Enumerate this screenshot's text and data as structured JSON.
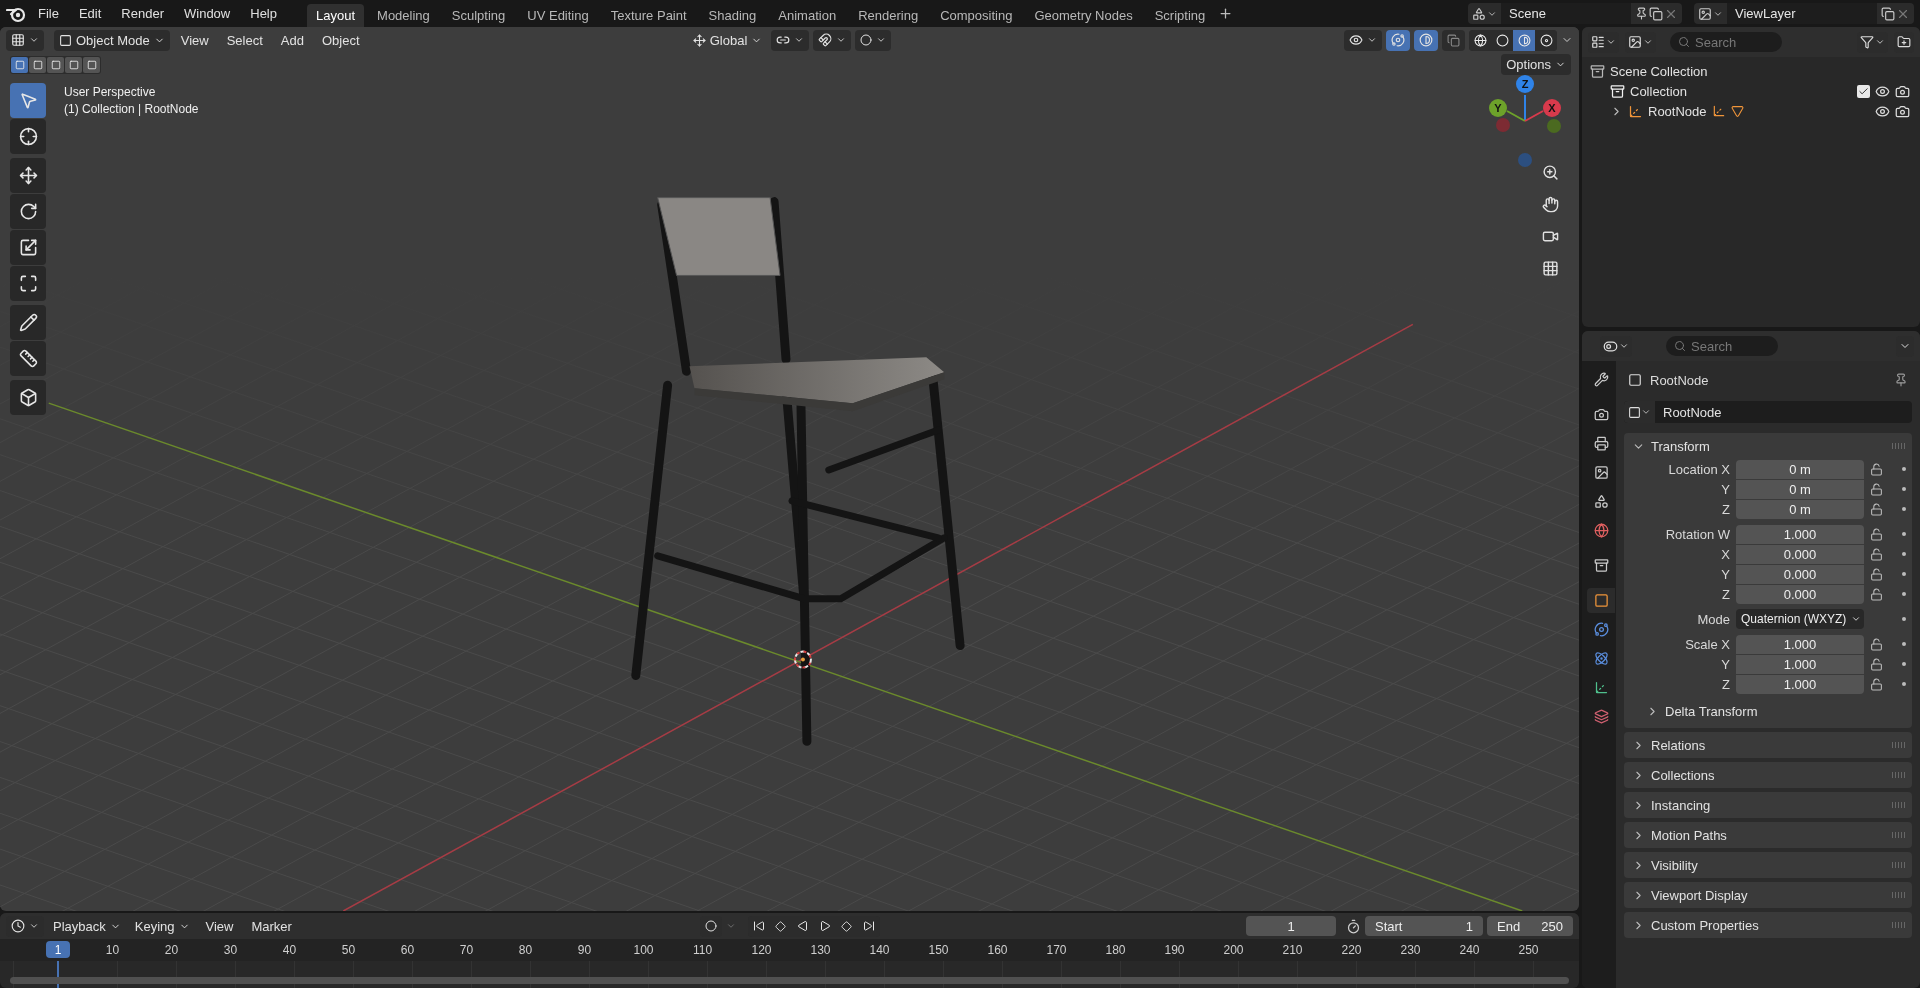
{
  "menu": [
    "File",
    "Edit",
    "Render",
    "Window",
    "Help"
  ],
  "workspaces": [
    {
      "label": "Layout",
      "selected": true
    },
    {
      "label": "Modeling",
      "selected": false
    },
    {
      "label": "Sculpting",
      "selected": false
    },
    {
      "label": "UV Editing",
      "selected": false
    },
    {
      "label": "Texture Paint",
      "selected": false
    },
    {
      "label": "Shading",
      "selected": false
    },
    {
      "label": "Animation",
      "selected": false
    },
    {
      "label": "Rendering",
      "selected": false
    },
    {
      "label": "Compositing",
      "selected": false
    },
    {
      "label": "Geometry Nodes",
      "selected": false
    },
    {
      "label": "Scripting",
      "selected": false
    }
  ],
  "scene": "Scene",
  "view_layer": "ViewLayer",
  "viewport": {
    "mode": "Object Mode",
    "menus": [
      "View",
      "Select",
      "Add",
      "Object"
    ],
    "orientation": "Global",
    "options": "Options",
    "view_name": "User Perspective",
    "view_info": "(1) Collection | RootNode",
    "select_modes": [
      {
        "selected": true
      },
      {
        "selected": false
      },
      {
        "selected": false
      },
      {
        "selected": false
      },
      {
        "selected": false
      }
    ],
    "tools": [
      {
        "kind": "select",
        "selected": true
      },
      {
        "kind": "cursor",
        "selected": false
      },
      {
        "kind": "move",
        "selected": false
      },
      {
        "kind": "rotate",
        "selected": false
      },
      {
        "kind": "scale",
        "selected": false
      },
      {
        "kind": "transform",
        "selected": false
      },
      {
        "kind": "annotate",
        "selected": false
      },
      {
        "kind": "measure",
        "selected": false
      },
      {
        "kind": "add_cube",
        "selected": false
      }
    ],
    "shading": [
      {
        "kind": "wireframe",
        "selected": false
      },
      {
        "kind": "solid",
        "selected": false
      },
      {
        "kind": "material",
        "selected": true
      },
      {
        "kind": "rendered",
        "selected": false
      }
    ],
    "gizmo": [
      {
        "kind": "z",
        "label": "Z"
      },
      {
        "kind": "y",
        "label": "Y"
      },
      {
        "kind": "x",
        "label": "X"
      }
    ]
  },
  "outliner": {
    "search_placeholder": "Search",
    "tree": [
      {
        "label": "Scene Collection",
        "kind": "scene_collection",
        "children": [
          {
            "label": "Collection",
            "kind": "collection",
            "checked": true
          },
          {
            "label": "RootNode",
            "kind": "empty",
            "expanded": false
          }
        ]
      }
    ]
  },
  "properties": {
    "search_placeholder": "Search",
    "tabs": [
      {
        "kind": "tool",
        "selected": false
      },
      {
        "kind": "render",
        "selected": false
      },
      {
        "kind": "output",
        "selected": false
      },
      {
        "kind": "view_layer",
        "selected": false
      },
      {
        "kind": "scene",
        "selected": false
      },
      {
        "kind": "world",
        "selected": false
      },
      {
        "kind": "collection",
        "selected": false
      },
      {
        "kind": "object",
        "selected": true
      },
      {
        "kind": "physics",
        "selected": false
      },
      {
        "kind": "constraints",
        "selected": false
      },
      {
        "kind": "data",
        "selected": false
      },
      {
        "kind": "texture",
        "selected": false
      }
    ],
    "object_name": "RootNode",
    "datablock": "RootNode",
    "transform": {
      "title": "Transform",
      "expanded": true,
      "rows": [
        {
          "kind": "number",
          "label": "Location X",
          "value": "0 m"
        },
        {
          "kind": "number",
          "label": "Y",
          "value": "0 m"
        },
        {
          "kind": "number",
          "label": "Z",
          "value": "0 m"
        },
        {
          "kind": "number",
          "label": "Rotation W",
          "value": "1.000"
        },
        {
          "kind": "number",
          "label": "X",
          "value": "0.000"
        },
        {
          "kind": "number",
          "label": "Y",
          "value": "0.000"
        },
        {
          "kind": "number",
          "label": "Z",
          "value": "0.000"
        },
        {
          "kind": "dropdown",
          "label": "Mode",
          "value": "Quaternion (WXYZ)"
        },
        {
          "kind": "number",
          "label": "Scale X",
          "value": "1.000"
        },
        {
          "kind": "number",
          "label": "Y",
          "value": "1.000"
        },
        {
          "kind": "number",
          "label": "Z",
          "value": "1.000"
        }
      ],
      "subpanel": {
        "title": "Delta Transform",
        "expanded": false
      }
    },
    "panels": [
      {
        "title": "Relations",
        "expanded": false
      },
      {
        "title": "Collections",
        "expanded": false
      },
      {
        "title": "Instancing",
        "expanded": false
      },
      {
        "title": "Motion Paths",
        "expanded": false
      },
      {
        "title": "Visibility",
        "expanded": false
      },
      {
        "title": "Viewport Display",
        "expanded": false
      },
      {
        "title": "Custom Properties",
        "expanded": false
      }
    ]
  },
  "timeline": {
    "menus": [
      "Playback",
      "Keying",
      "View",
      "Marker"
    ],
    "current_frame": "1",
    "start_label": "Start",
    "start": "1",
    "end_label": "End",
    "end": "250",
    "playhead": "1",
    "ticks": [
      "10",
      "20",
      "30",
      "40",
      "50",
      "60",
      "70",
      "80",
      "90",
      "100",
      "110",
      "120",
      "130",
      "140",
      "150",
      "160",
      "170",
      "180",
      "190",
      "200",
      "210",
      "220",
      "230",
      "240",
      "250"
    ]
  }
}
